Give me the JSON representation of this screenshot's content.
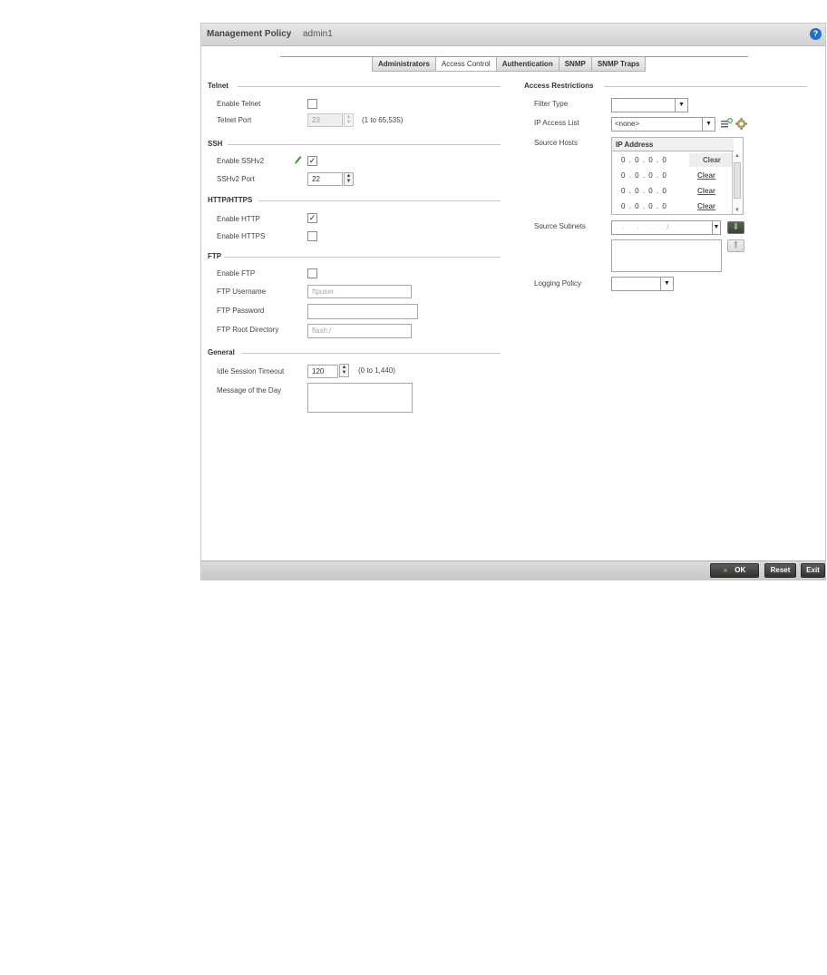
{
  "window": {
    "title": "Management Policy",
    "subtitle": "admin1",
    "help_icon": "?"
  },
  "tabs": [
    {
      "label": "Administrators",
      "active": false
    },
    {
      "label": "Access Control",
      "active": true
    },
    {
      "label": "Authentication",
      "active": false
    },
    {
      "label": "SNMP",
      "active": false
    },
    {
      "label": "SNMP Traps",
      "active": false
    }
  ],
  "telnet": {
    "section": "Telnet",
    "enable_label": "Enable Telnet",
    "enable_checked": false,
    "port_label": "Telnet Port",
    "port_value": "23",
    "port_hint": "(1 to 65,535)"
  },
  "ssh": {
    "section": "SSH",
    "enable_label": "Enable SSHv2",
    "enable_checked": true,
    "enable_mark": "✓",
    "port_label": "SSHv2 Port",
    "port_value": "22"
  },
  "http": {
    "section": "HTTP/HTTPS",
    "http_label": "Enable HTTP",
    "http_checked": true,
    "http_mark": "✓",
    "https_label": "Enable HTTPS",
    "https_checked": false
  },
  "ftp": {
    "section": "FTP",
    "enable_label": "Enable FTP",
    "enable_checked": false,
    "username_label": "FTP Username",
    "username_value": "ftpuser",
    "password_label": "FTP Password",
    "password_value": "",
    "rootdir_label": "FTP Root Directory",
    "rootdir_value": "flash:/"
  },
  "general": {
    "section": "General",
    "timeout_label": "Idle Session Timeout",
    "timeout_value": "120",
    "timeout_hint": "(0 to 1,440)",
    "motd_label": "Message of the Day",
    "motd_value": ""
  },
  "access": {
    "section": "Access Restrictions",
    "filter_label": "Filter Type",
    "filter_value": "",
    "acl_label": "IP Access List",
    "acl_value": "<none>",
    "hosts_label": "Source Hosts",
    "hosts_header": "IP Address",
    "hosts": [
      {
        "ip": "0 . 0 . 0 . 0",
        "clear": "Clear"
      },
      {
        "ip": "0 . 0 . 0 . 0",
        "clear": "Clear"
      },
      {
        "ip": "0 . 0 . 0 . 0",
        "clear": "Clear"
      },
      {
        "ip": "0 . 0 . 0 . 0",
        "clear": "Clear"
      }
    ],
    "subnets_label": "Source Subnets",
    "subnet_value": ". . . /",
    "logging_label": "Logging Policy",
    "logging_value": ""
  },
  "footer": {
    "ok": "OK",
    "reset": "Reset",
    "exit": "Exit"
  },
  "colors": {
    "accent_help": "#1f6fd0",
    "add_arrow": "#6fd65a",
    "ok_chevron": "#f39c12"
  }
}
